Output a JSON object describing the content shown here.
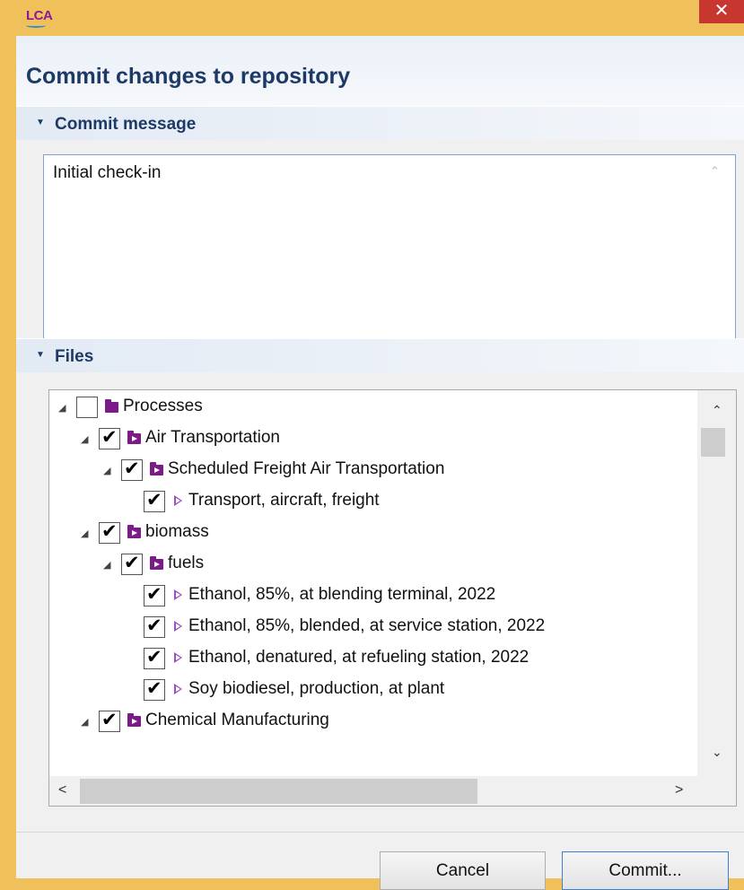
{
  "window": {
    "app_logo": "LCA",
    "close_glyph": "✕"
  },
  "dialog": {
    "title": "Commit changes to repository"
  },
  "commit_section": {
    "label": "Commit message",
    "message": "Initial check-in"
  },
  "files_section": {
    "label": "Files"
  },
  "tree": [
    {
      "label": "Processes",
      "checked": false,
      "icon": "folder-icon",
      "expander": "◢"
    },
    {
      "label": "Air Transportation",
      "checked": true,
      "icon": "process-folder-icon",
      "expander": "◢"
    },
    {
      "label": "Scheduled Freight Air Transportation",
      "checked": true,
      "icon": "process-folder-icon",
      "expander": "◢"
    },
    {
      "label": "Transport, aircraft, freight",
      "checked": true,
      "icon": "process-icon",
      "expander": ""
    },
    {
      "label": "biomass",
      "checked": true,
      "icon": "process-folder-icon",
      "expander": "◢"
    },
    {
      "label": "fuels",
      "checked": true,
      "icon": "process-folder-icon",
      "expander": "◢"
    },
    {
      "label": "Ethanol, 85%, at blending terminal, 2022",
      "checked": true,
      "icon": "process-icon",
      "expander": ""
    },
    {
      "label": "Ethanol, 85%, blended, at service station, 2022",
      "checked": true,
      "icon": "process-icon",
      "expander": ""
    },
    {
      "label": "Ethanol, denatured, at refueling station, 2022",
      "checked": true,
      "icon": "process-icon",
      "expander": ""
    },
    {
      "label": "Soy biodiesel, production, at plant",
      "checked": true,
      "icon": "process-icon",
      "expander": ""
    },
    {
      "label": "Chemical Manufacturing",
      "checked": true,
      "icon": "process-folder-icon",
      "expander": "◢"
    }
  ],
  "buttons": {
    "cancel": "Cancel",
    "commit": "Commit..."
  },
  "colors": {
    "title_text": "#1d3a66",
    "window_frame": "#f0c05a",
    "close_button": "#c7372f",
    "folder": "#7a1b87"
  }
}
